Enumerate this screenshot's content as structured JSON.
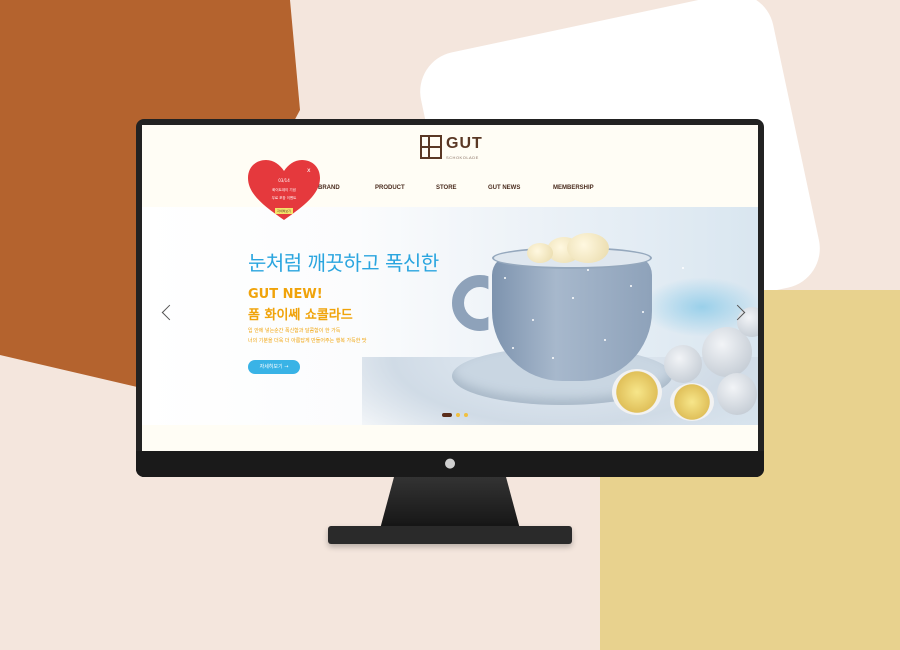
{
  "colors": {
    "background": "#f4e6dd",
    "bg_brown": "#b4632e",
    "bg_yellow": "#e8d28e",
    "headline_blue": "#2aa5df",
    "accent_orange": "#f0a30a",
    "button_blue": "#39b3e6",
    "heart_red": "#e5393d"
  },
  "site": {
    "logo": {
      "text": "GUT",
      "subtitle": "SCHOKOLADE"
    },
    "nav": [
      {
        "label": "BRAND"
      },
      {
        "label": "PRODUCT"
      },
      {
        "label": "STORE"
      },
      {
        "label": "GUT NEWS"
      },
      {
        "label": "MEMBERSHIP"
      }
    ],
    "popup": {
      "date": "03/14",
      "line1": "화이트데이 기념",
      "line2": "무료 포장 이벤트",
      "button": "자세히보기",
      "close": "x"
    },
    "hero": {
      "headline": "눈처럼 깨끗하고 폭신한",
      "title_line1": "GUT NEW!",
      "title_line2": "폼 화이쎄 쇼콜라드",
      "desc_line1": "입 안에 넣는순간 폭신함과 달콤함이 한 가득",
      "desc_line2": "너의 기분을 더욱 더 아름답게 만들어주는 행복 가득한 맛",
      "button": "자세히보기 →",
      "slides": 3,
      "active_slide": 1
    },
    "icons": [
      "apple-logo-icon",
      "chevron-left-icon",
      "chevron-right-icon",
      "close-icon",
      "heart-icon"
    ]
  }
}
